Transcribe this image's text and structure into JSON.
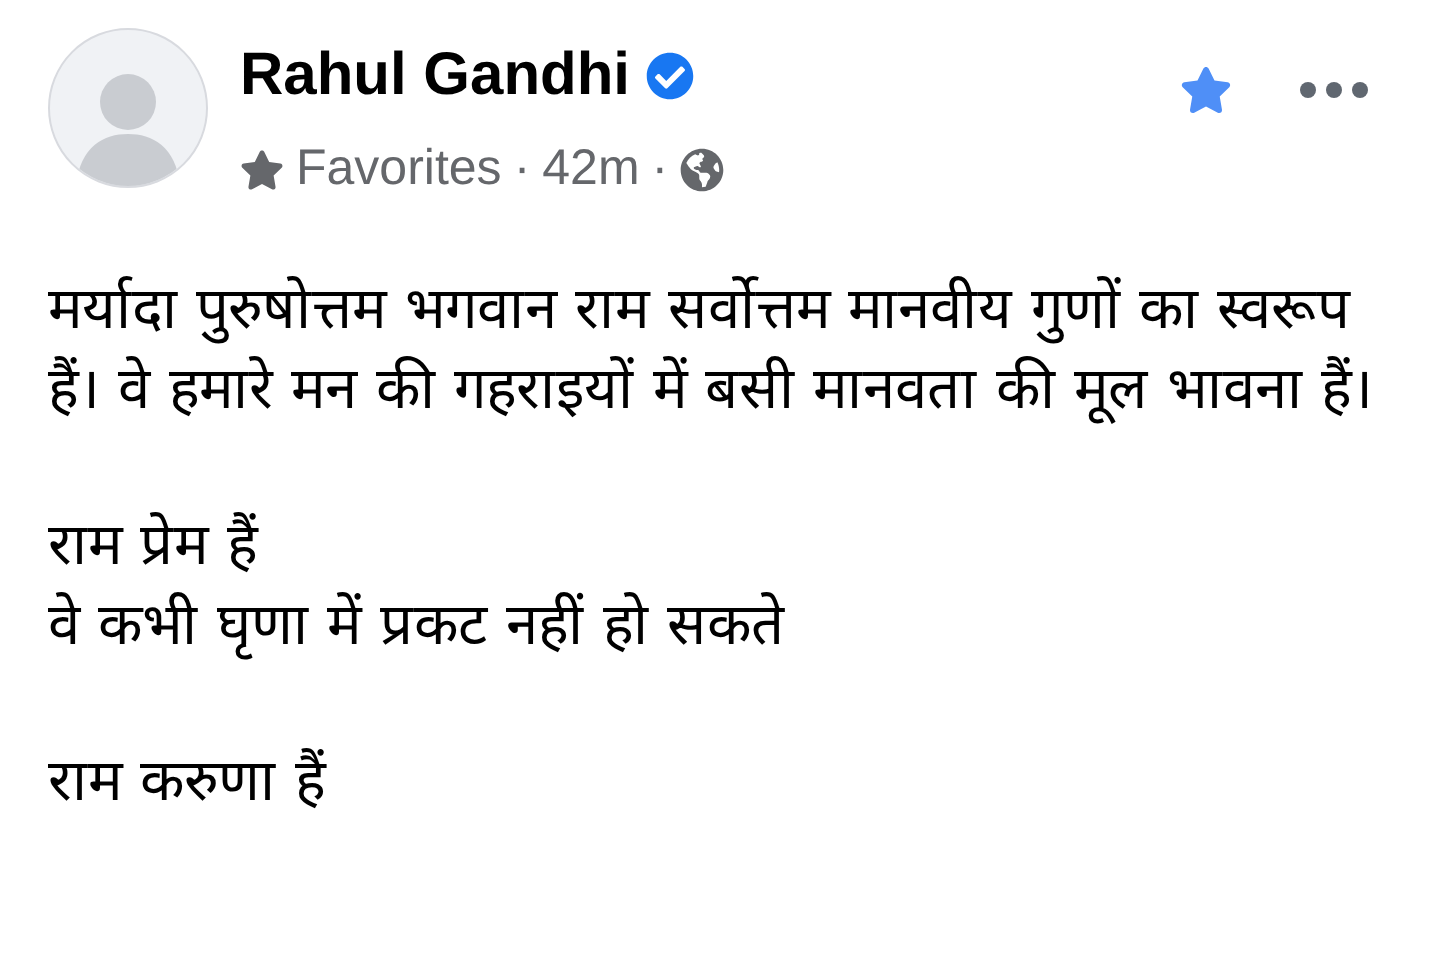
{
  "post": {
    "author": "Rahul Gandhi",
    "verified": true,
    "audience_label": "Favorites",
    "separator_1": "·",
    "time": "42m",
    "separator_2": "·",
    "favorite": true
  },
  "body": [
    {
      "lines": [
        "मर्यादा पुरुषोत्तम भगवान राम सर्वोत्तम मानवीय गुणों का स्वरूप हैं। वे हमारे मन की गहराइयों में बसी मानवता की मूल भावना हैं।"
      ]
    },
    {
      "lines": [
        "राम प्रेम हैं",
        "वे कभी घृणा में प्रकट नहीं हो सकते"
      ]
    },
    {
      "lines": [
        "राम करुणा हैं"
      ]
    }
  ]
}
